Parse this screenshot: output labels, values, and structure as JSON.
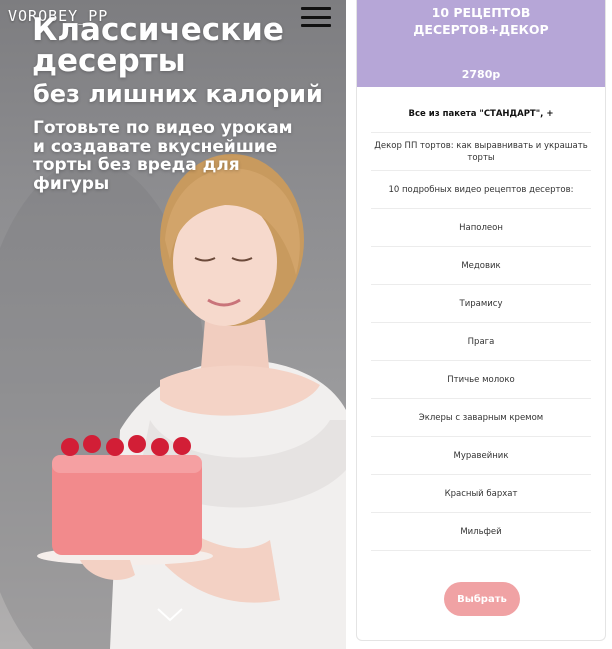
{
  "hero": {
    "brand": "VOROBEY_PP",
    "title_line1": "Классические",
    "title_line2": "десерты",
    "subtitle": "без лишних калорий",
    "description": "Готовьте по видео урокам и создавате вкуснейшие торты без вреда для фигуры",
    "menu_icon": "hamburger-menu-icon",
    "scroll_icon": "chevron-down-icon"
  },
  "card": {
    "title_line1": "10 РЕЦЕПТОВ",
    "title_line2": "ДЕСЕРТОВ+ДЕКОР",
    "price": "2780р",
    "features": [
      "Все из пакета \"СТАНДАРТ\", +",
      "Декор ПП тортов: как выравнивать и украшать торты",
      "10 подробных видео рецептов десертов:",
      "Наполеон",
      "Медовик",
      "Тирамису",
      "Прага",
      "Птичье молоко",
      "Эклеры с заварным кремом",
      "Муравейник",
      "Красный бархат",
      "Мильфей"
    ],
    "button_label": "Выбрать"
  },
  "colors": {
    "card_header": "#b6a6d7",
    "button": "#f0a2a4",
    "hero_background": "#8d8d90"
  }
}
